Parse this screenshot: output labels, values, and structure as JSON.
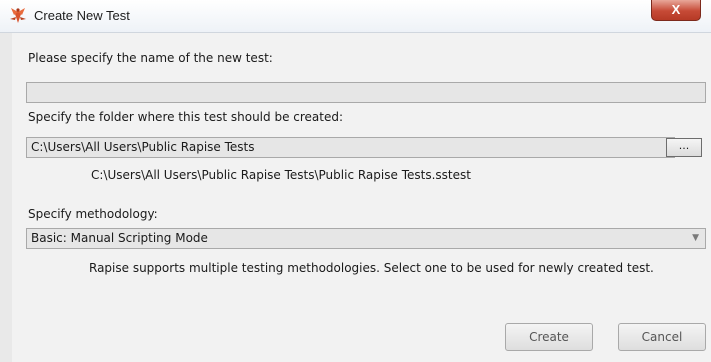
{
  "window": {
    "title": "Create New Test",
    "close_glyph": "X"
  },
  "form": {
    "name_label": "Please specify the name of the new test:",
    "name_value": "",
    "folder_label": "Specify the folder where this test should be created:",
    "folder_value": "C:\\Users\\All Users\\Public Rapise Tests",
    "browse_label": "...",
    "path_preview": "C:\\Users\\All Users\\Public Rapise Tests\\Public Rapise Tests.sstest",
    "methodology_label": "Specify methodology:",
    "methodology_value": "Basic: Manual Scripting Mode",
    "methodology_hint": "Rapise supports multiple testing methodologies. Select one to be used for newly created test."
  },
  "buttons": {
    "create": "Create",
    "cancel": "Cancel"
  },
  "colors": {
    "close_button": "#c64a36",
    "app_icon": "#d9532c"
  },
  "icons": {
    "app": "rapise-bug-icon",
    "close": "close-icon",
    "dropdown": "chevron-down-icon"
  }
}
